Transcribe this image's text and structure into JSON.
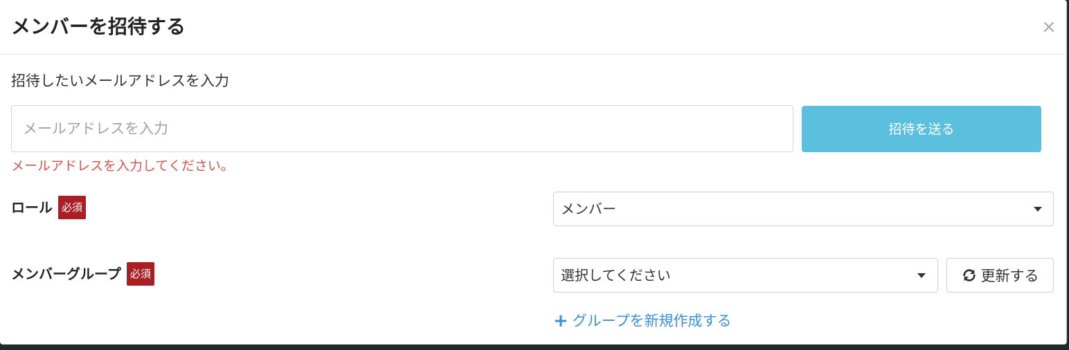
{
  "modal": {
    "title": "メンバーを招待する",
    "close_symbol": "×"
  },
  "email": {
    "label": "招待したいメールアドレスを入力",
    "placeholder": "メールアドレスを入力",
    "value": "",
    "send_button_label": "招待を送る",
    "error_message": "メールアドレスを入力してください。"
  },
  "role": {
    "label": "ロール",
    "required_badge": "必須",
    "selected_value": "メンバー"
  },
  "member_group": {
    "label": "メンバーグループ",
    "required_badge": "必須",
    "selected_value": "選択してください",
    "refresh_button_label": "更新する",
    "add_group_link": "グループを新規作成する"
  },
  "colors": {
    "send_button_bg": "#5bc0de",
    "error_text": "#d9534f",
    "required_badge_bg": "#a81f26",
    "link": "#3c8fd9"
  },
  "icons": {
    "close": "close-icon",
    "caret": "chevron-down-icon",
    "refresh": "refresh-icon",
    "plus": "plus-icon"
  }
}
